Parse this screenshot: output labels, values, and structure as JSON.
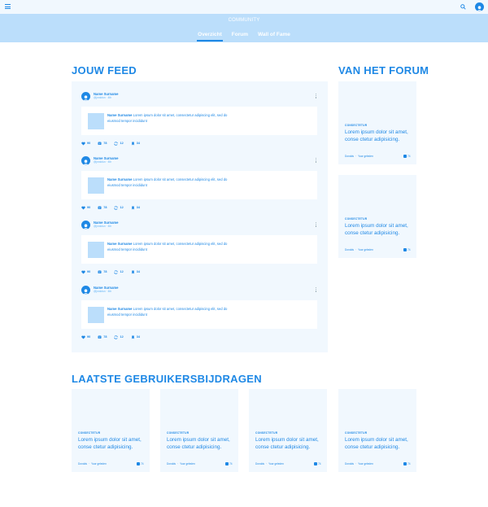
{
  "topbar": {
    "menu_icon": "hamburger-icon",
    "search_icon": "search-icon",
    "avatar_icon": "user-avatar-icon"
  },
  "community": {
    "title": "COMMUNITY",
    "tabs": [
      {
        "label": "Overzicht",
        "active": true
      },
      {
        "label": "Forum",
        "active": false
      },
      {
        "label": "Wall of Fame",
        "active": false
      }
    ]
  },
  "feed": {
    "heading": "JOUW FEED",
    "posts": [
      {
        "name": "Name Surname",
        "handle": "@jnrdotun · 4th",
        "card_author": "Name Surname",
        "card_text": "Lorem ipsum dolor sit amet, consectetur adipiscing elit, sed do eiusmod tempor incididunt",
        "likes": "90",
        "comments": "78",
        "reposts": "12",
        "saves": "34"
      },
      {
        "name": "Name Surname",
        "handle": "@jnrdotun · 4th",
        "card_author": "Name Surname",
        "card_text": "Lorem ipsum dolor sit amet, consectetur adipiscing elit, sed do eiusmod tempor incididunt",
        "likes": "90",
        "comments": "78",
        "reposts": "12",
        "saves": "34"
      },
      {
        "name": "Name Surname",
        "handle": "@jnrdotun · 4th",
        "card_author": "Name Surname",
        "card_text": "Lorem ipsum dolor sit amet, consectetur adipiscing elit, sed do eiusmod tempor incididunt",
        "likes": "90",
        "comments": "78",
        "reposts": "12",
        "saves": "34"
      },
      {
        "name": "Name Surname",
        "handle": "@jnrdotun · 4th",
        "card_author": "Name Surname",
        "card_text": "Lorem ipsum dolor sit amet, consectetur adipiscing elit, sed do eiusmod tempor incididunt",
        "likes": "90",
        "comments": "78",
        "reposts": "12",
        "saves": "34"
      }
    ]
  },
  "forum": {
    "heading": "VAN HET FORUM",
    "cards": [
      {
        "category": "CONSECTETUR",
        "title": "Lorem ipsum dolor sit amet, conse ctetur adipisicing.",
        "author": "Dondds",
        "date": "Yuor geleden",
        "count": "74"
      },
      {
        "category": "CONSECTETUR",
        "title": "Lorem ipsum dolor sit amet, conse ctetur adipisicing.",
        "author": "Dondds",
        "date": "Yuor geleden",
        "count": "74"
      }
    ]
  },
  "contributions": {
    "heading": "LAATSTE GEBRUIKERSBIJDRAGEN",
    "cards": [
      {
        "category": "CONSECTETUR",
        "title": "Lorem ipsum dolor sit amet, conse ctetur adipisicing.",
        "author": "Dondds",
        "date": "Yuor geleden",
        "count": "74"
      },
      {
        "category": "CONSECTETUR",
        "title": "Lorem ipsum dolor sit amet, conse ctetur adipisicing.",
        "author": "Dondds",
        "date": "Yuor geleden",
        "count": "74"
      },
      {
        "category": "CONSECTETUR",
        "title": "Lorem ipsum dolor sit amet, conse ctetur adipisicing.",
        "author": "Dondds",
        "date": "Yuor geleden",
        "count": "74"
      },
      {
        "category": "CONSECTETUR",
        "title": "Lorem ipsum dolor sit amet, conse ctetur adipisicing.",
        "author": "Dondds",
        "date": "Yuor geleden",
        "count": "74"
      }
    ]
  },
  "colors": {
    "accent": "#1e88e5",
    "header_bg": "#bbdefb",
    "panel_bg": "#f1f8fe"
  }
}
